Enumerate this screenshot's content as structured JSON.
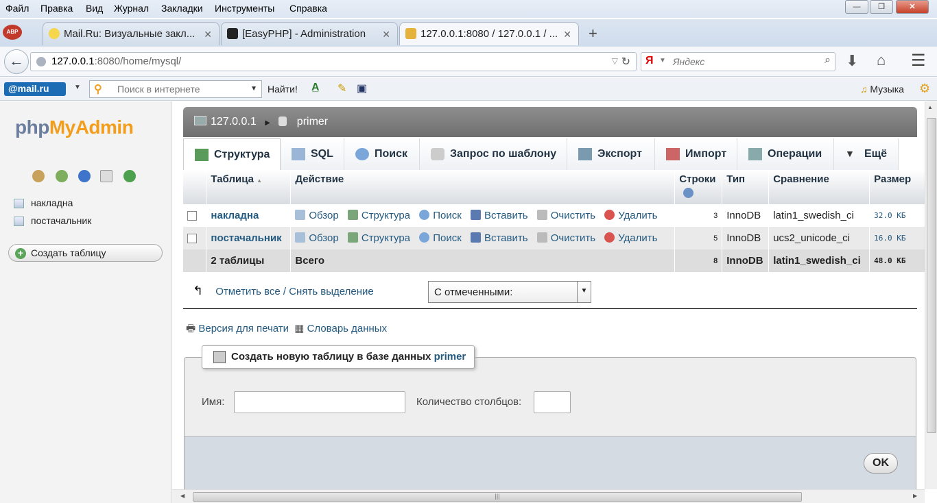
{
  "menubar": {
    "items": [
      "Файл",
      "Правка",
      "Вид",
      "Журнал",
      "Закладки",
      "Инструменты",
      "Справка"
    ]
  },
  "tabs": [
    {
      "label": "Mail.Ru: Визуальные закл...",
      "active": false
    },
    {
      "label": "[EasyPHP] - Administration",
      "active": false
    },
    {
      "label": "127.0.0.1:8080 / 127.0.0.1 / ...",
      "active": true
    }
  ],
  "nav": {
    "url_host": "127.0.0.1",
    "url_rest": ":8080/home/mysql/",
    "search_placeholder": "Яндекс"
  },
  "mailbar": {
    "logo": "@mail.ru",
    "search_placeholder": "Поиск в интернете",
    "find_label": "Найти!",
    "music_label": "Музыка"
  },
  "sidebar": {
    "logo_php": "php",
    "logo_my": "MyAdmin",
    "databases": [
      "накладна",
      "постачальник"
    ],
    "create_table_label": "Создать таблицу"
  },
  "breadcrumb": {
    "server": "127.0.0.1",
    "database": "primer"
  },
  "main_tabs": [
    {
      "label": "Структура",
      "active": true
    },
    {
      "label": "SQL",
      "active": false
    },
    {
      "label": "Поиск",
      "active": false
    },
    {
      "label": "Запрос по шаблону",
      "active": false
    },
    {
      "label": "Экспорт",
      "active": false
    },
    {
      "label": "Импорт",
      "active": false
    },
    {
      "label": "Операции",
      "active": false
    },
    {
      "label": "Ещё",
      "active": false
    }
  ],
  "table": {
    "headers": {
      "table": "Таблица",
      "action": "Действие",
      "rows": "Строки",
      "type": "Тип",
      "collation": "Сравнение",
      "size": "Размер"
    },
    "actions": [
      "Обзор",
      "Структура",
      "Поиск",
      "Вставить",
      "Очистить",
      "Удалить"
    ],
    "rows": [
      {
        "name": "накладна",
        "rows": "3",
        "type": "InnoDB",
        "collation": "latin1_swedish_ci",
        "size": "32.0 КБ"
      },
      {
        "name": "постачальник",
        "rows": "5",
        "type": "InnoDB",
        "collation": "ucs2_unicode_ci",
        "size": "16.0 КБ"
      }
    ],
    "total": {
      "name": "2 таблицы",
      "label": "Всего",
      "rows": "8",
      "type": "InnoDB",
      "collation": "latin1_swedish_ci",
      "size": "48.0 КБ"
    }
  },
  "bulk": {
    "check_all_label": "Отметить все / Снять выделение",
    "with_selected": "С отмеченными:"
  },
  "links": {
    "print_label": "Версия для печати",
    "dict_label": "Словарь данных"
  },
  "create_form": {
    "legend": "Создать новую таблицу в базе данных",
    "db_name": "primer",
    "name_label": "Имя:",
    "cols_label": "Количество столбцов:",
    "ok_label": "OK"
  },
  "colors": {
    "link": "#235a81",
    "crumb_bg": "#7a7a7a",
    "logo_orange": "#f29d1b"
  }
}
